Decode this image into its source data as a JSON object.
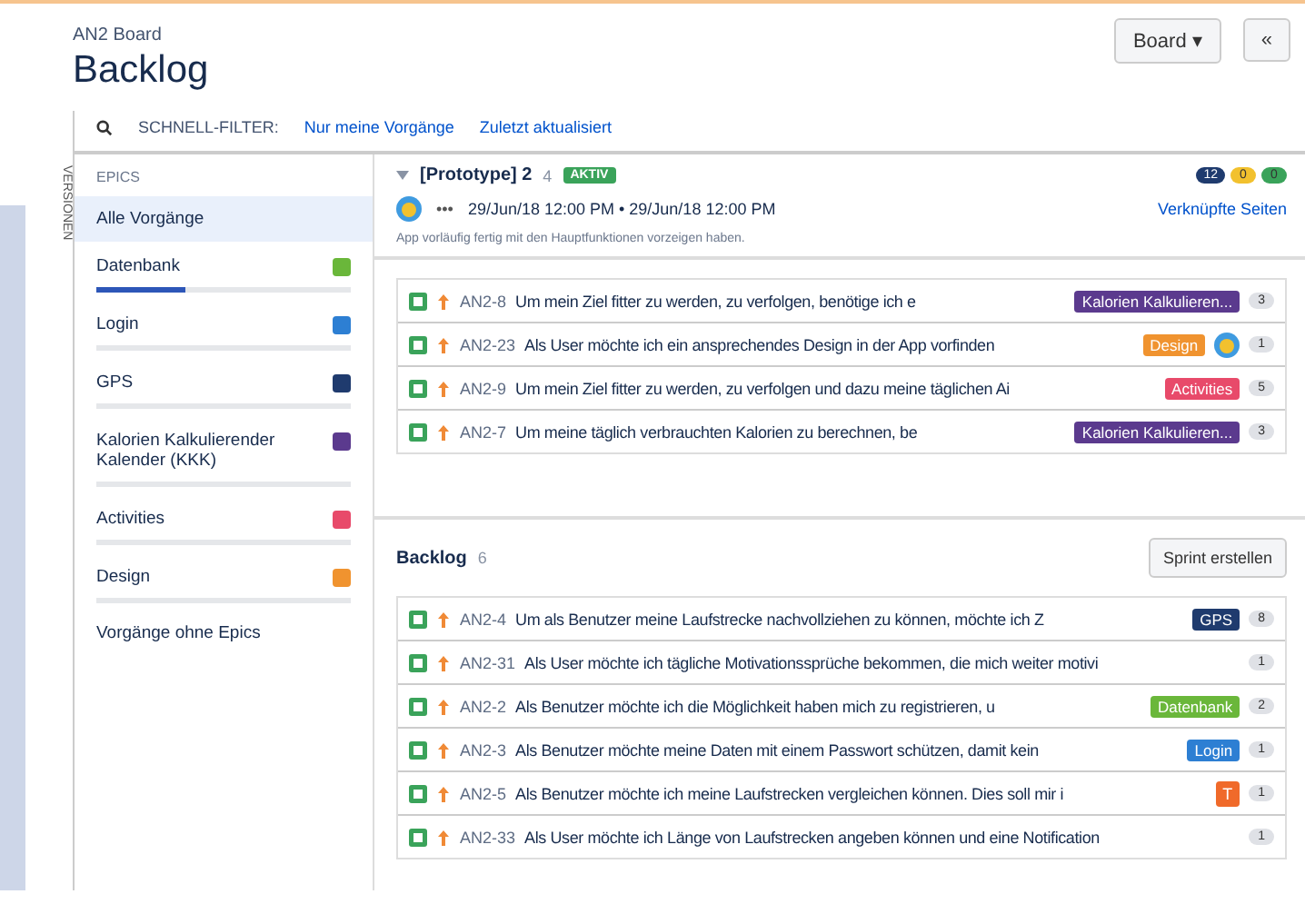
{
  "header": {
    "board": "AN2 Board",
    "title": "Backlog",
    "buttons": [
      {
        "label": "Board ▾"
      },
      {
        "label": "«"
      }
    ]
  },
  "filters": {
    "label": "SCHNELL-FILTER:",
    "items": [
      "Nur meine Vorgänge",
      "Zuletzt aktualisiert"
    ]
  },
  "side_tab": "VERSIONEN",
  "epics": {
    "title": "EPICS",
    "items": [
      {
        "name": "Alle Vorgänge",
        "kind": "all",
        "selected": true
      },
      {
        "name": "Datenbank",
        "kind": "epic",
        "color": "#6ab73a",
        "level": 0.35,
        "selected": false
      },
      {
        "name": "Login",
        "kind": "epic",
        "color": "#2d7fd3",
        "selected": false
      },
      {
        "name": "GPS",
        "kind": "epic",
        "color": "#1f3b6e",
        "selected": false
      },
      {
        "name": "Kalorien Kalkulierender Kalender (KKK)",
        "kind": "epic",
        "color": "#5b3a8e",
        "selected": false
      },
      {
        "name": "Activities",
        "kind": "epic",
        "color": "#e84a6a",
        "selected": false
      },
      {
        "name": "Design",
        "kind": "epic",
        "color": "#f0932f",
        "selected": false
      },
      {
        "name": "Vorgänge ohne Epics",
        "kind": "all",
        "selected": false
      }
    ]
  },
  "sprint": {
    "name": "[Prototype] 2",
    "count": "4",
    "status": "AKTIV",
    "counts": [
      {
        "value": "12",
        "color": "#1f3b6e"
      },
      {
        "value": "0",
        "color": "#f2c12e"
      },
      {
        "value": "0",
        "color": "#3aa35a"
      }
    ],
    "more": "•••",
    "dates": "29/Jun/18 12:00 PM • 29/Jun/18 12:00 PM",
    "link": "Verknüpfte Seiten",
    "goal": "App vorläufig fertig mit den Hauptfunktionen vorzeigen haben.",
    "issues": [
      {
        "key": "AN2-8",
        "summary": "Um mein Ziel fitter zu werden, zu verfolgen, benötige ich e",
        "epic": {
          "label": "Kalorien Kalkulieren...",
          "color": "#5b3a8e"
        },
        "estimate": "3"
      },
      {
        "key": "AN2-23",
        "summary": "Als User möchte ich ein ansprechendes Design in der App vorfinden",
        "epic": {
          "label": "Design",
          "color": "#f0932f"
        },
        "avatar": true,
        "estimate": "1"
      },
      {
        "key": "AN2-9",
        "summary": "Um mein Ziel fitter zu werden, zu verfolgen und dazu meine täglichen Ai",
        "epic": {
          "label": "Activities",
          "color": "#e84a6a"
        },
        "estimate": "5"
      },
      {
        "key": "AN2-7",
        "summary": "Um meine täglich verbrauchten Kalorien zu berechnen, be",
        "epic": {
          "label": "Kalorien Kalkulieren...",
          "color": "#5b3a8e"
        },
        "estimate": "3"
      }
    ]
  },
  "backlog": {
    "name": "Backlog",
    "count": "6",
    "button": "Sprint erstellen",
    "issues": [
      {
        "key": "AN2-4",
        "summary": "Um als Benutzer meine Laufstrecke nachvollziehen zu können, möchte ich Z",
        "epic": {
          "label": "GPS",
          "color": "#1f3b6e"
        },
        "estimate": "8"
      },
      {
        "key": "AN2-31",
        "summary": "Als User möchte ich tägliche Motivationssprüche bekommen, die mich weiter motivi",
        "estimate": "1"
      },
      {
        "key": "AN2-2",
        "summary": "Als Benutzer möchte ich die Möglichkeit haben mich zu registrieren, u",
        "epic": {
          "label": "Datenbank",
          "color": "#6ab73a"
        },
        "estimate": "2"
      },
      {
        "key": "AN2-3",
        "summary": "Als Benutzer möchte meine Daten mit einem Passwort schützen, damit kein",
        "epic": {
          "label": "Login",
          "color": "#2d7fd3"
        },
        "estimate": "1"
      },
      {
        "key": "AN2-5",
        "summary": "Als Benutzer möchte ich meine Laufstrecken vergleichen können. Dies soll mir i",
        "letter": "T",
        "estimate": "1"
      },
      {
        "key": "AN2-33",
        "summary": "Als User möchte ich Länge von Laufstrecken angeben können und eine Notification",
        "estimate": "1"
      }
    ]
  }
}
